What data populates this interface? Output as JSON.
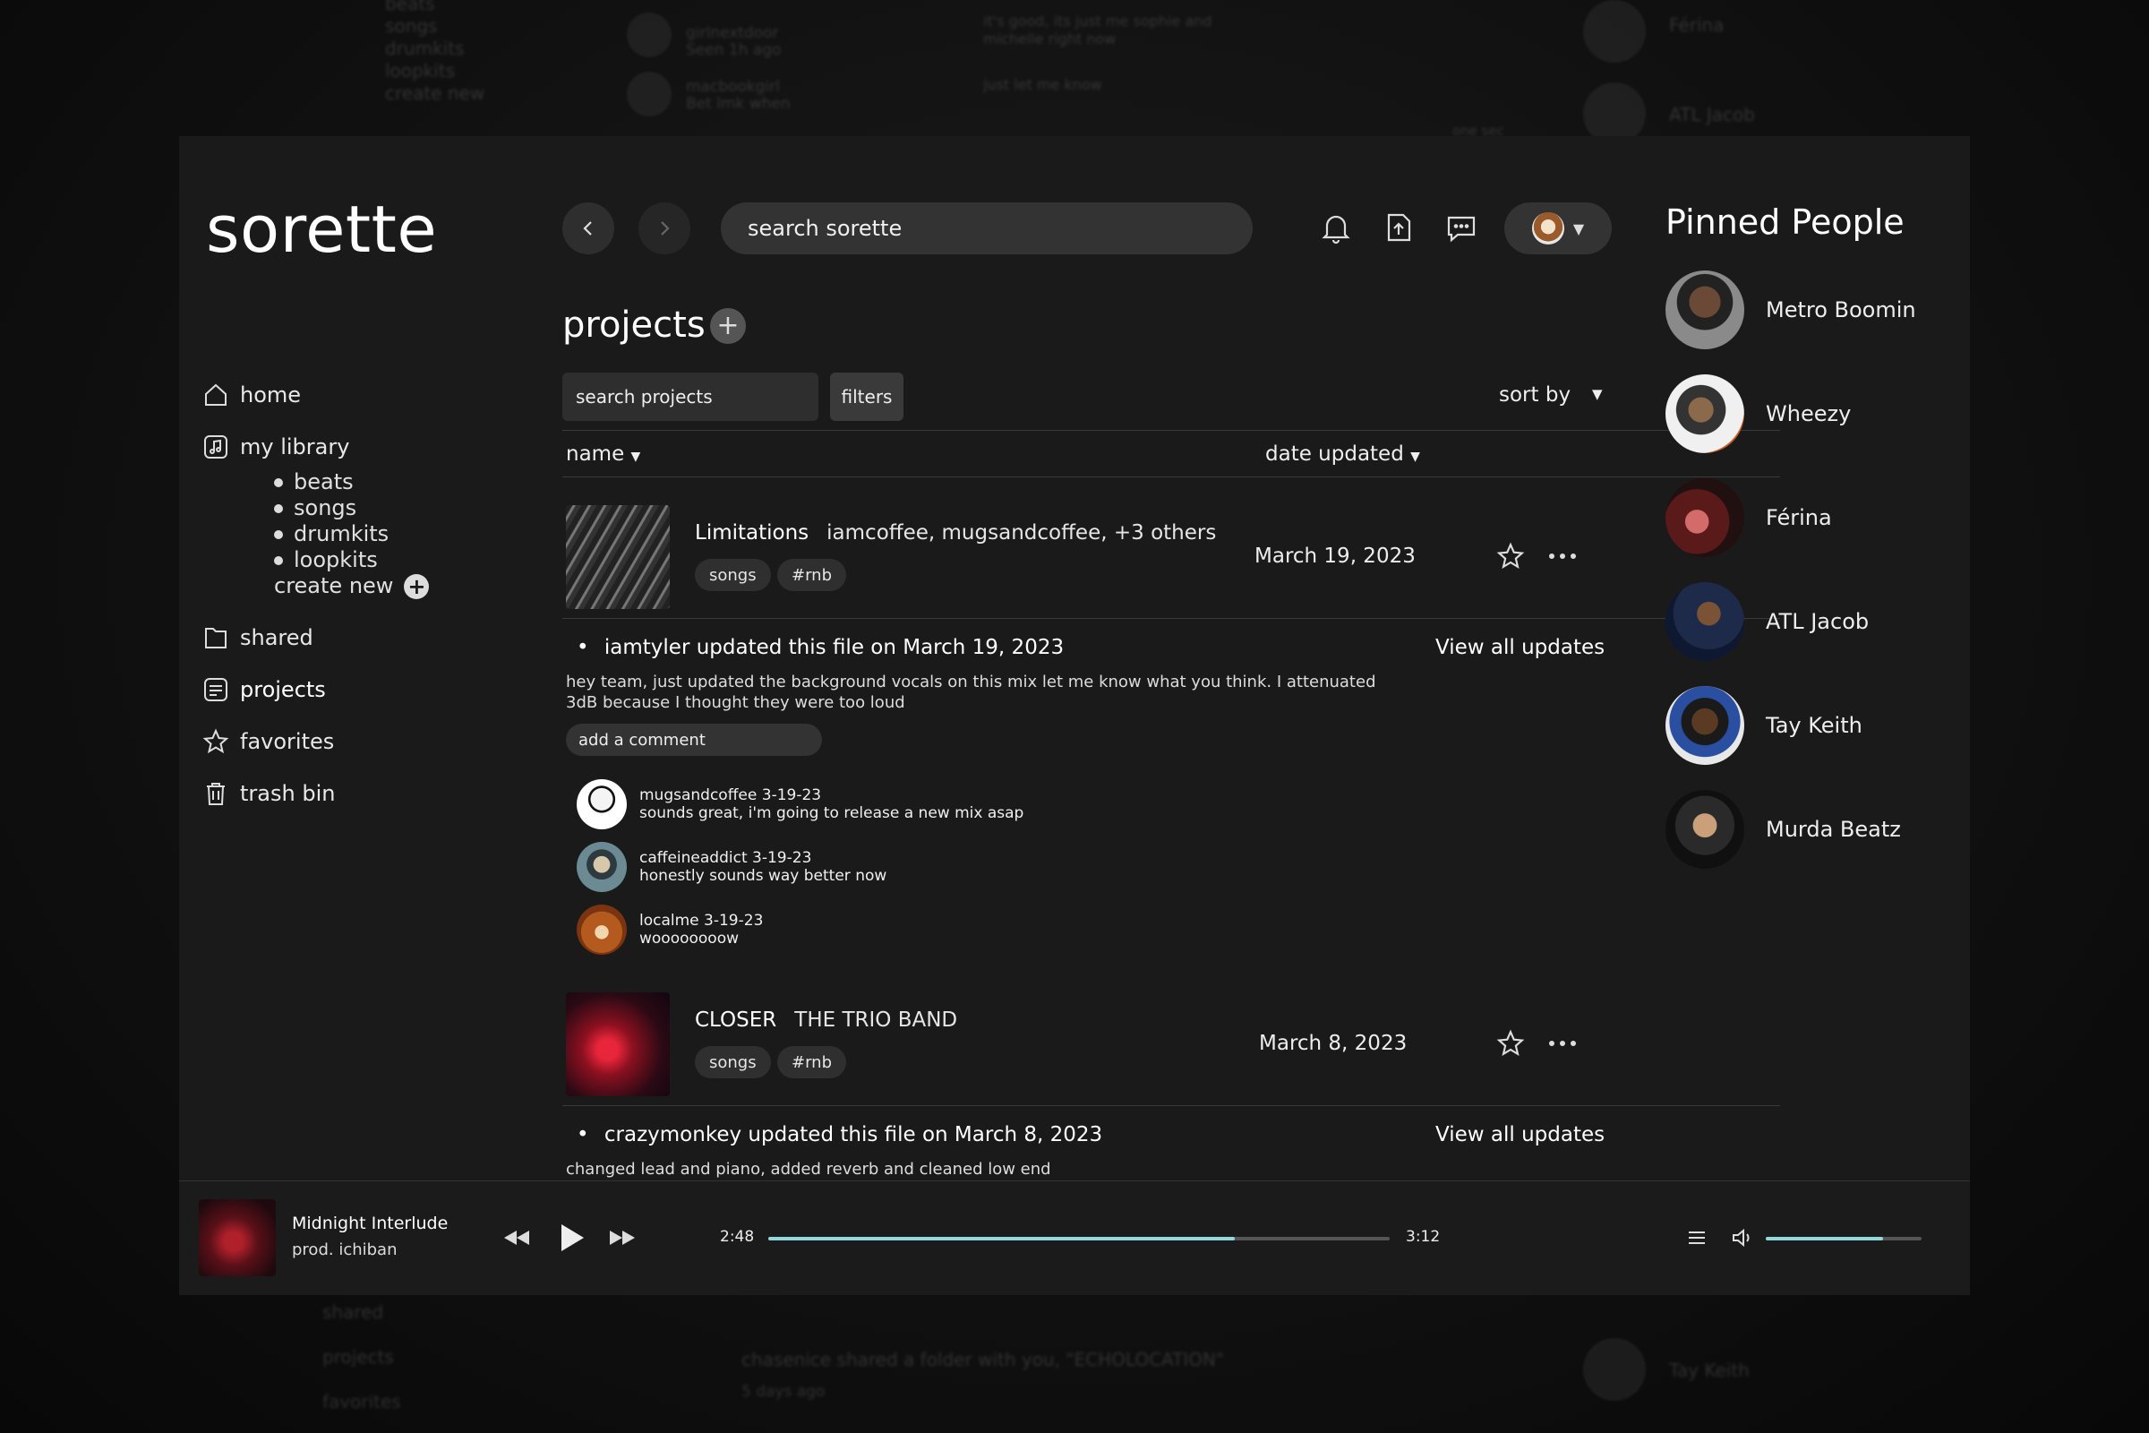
{
  "app": {
    "logo": "sorette"
  },
  "background": {
    "left_text": [
      "beats",
      "songs",
      "drumkits",
      "loopkits",
      "create new"
    ],
    "msgs": [
      {
        "name": "girlnextdoor",
        "sub": "Seen 1h ago"
      },
      {
        "name": "macbookgirl",
        "sub": "Bet lmk when"
      }
    ],
    "bubble1": "it's good, its just me sophie and michelle right now",
    "bubble2": "just let me know",
    "bubble3": "one sec",
    "right_names": [
      "Férina",
      "ATL Jacob"
    ],
    "bottom_text": "chasenice shared a folder with you, \"ECHOLOCATION\"",
    "bottom_sub": "5 days ago",
    "bottom_left": [
      "shared",
      "projects",
      "favorites"
    ],
    "bottom_right": "Tay Keith"
  },
  "sidebar": {
    "home": "home",
    "my_library": "my library",
    "library_items": [
      "beats",
      "songs",
      "drumkits",
      "loopkits"
    ],
    "create_new": "create new",
    "shared": "shared",
    "projects": "projects",
    "favorites": "favorites",
    "trash": "trash bin"
  },
  "topbar": {
    "search_placeholder": "search sorette"
  },
  "main": {
    "title": "projects",
    "search_projects": "search projects",
    "filters": "filters",
    "sort_by": "sort by",
    "col_name": "name",
    "col_date": "date updated",
    "projects": [
      {
        "title": "Limitations",
        "artists": "iamcoffee, mugsandcoffee, +3 others",
        "tags": [
          "songs",
          "#rnb"
        ],
        "date": "March 19, 2023",
        "update_user": "iamtyler",
        "update_text": "updated this file on March 19, 2023",
        "update_body": "hey team, just updated the background vocals on this mix let me know what you think. I attenuated 3dB because I thought they were too loud",
        "view_all": "View all updates"
      },
      {
        "title": "CLOSER",
        "artists": "THE TRIO BAND",
        "tags": [
          "songs",
          "#rnb"
        ],
        "date": "March 8, 2023",
        "update_user": "crazymonkey",
        "update_text": "updated this file on March 8, 2023",
        "update_body": "changed lead and piano, added reverb and cleaned low end",
        "view_all": "View all updates"
      }
    ],
    "add_comment": "add a comment",
    "comments": [
      {
        "head": "mugsandcoffee 3-19-23",
        "body": "sounds great, i'm going to release a new mix asap"
      },
      {
        "head": "caffeineaddict 3-19-23",
        "body": "honestly sounds way better now"
      },
      {
        "head": "localme 3-19-23",
        "body": "woooooooow"
      }
    ]
  },
  "pinned": {
    "title": "Pinned People",
    "people": [
      "Metro Boomin",
      "Wheezy",
      "Férina",
      "ATL Jacob",
      "Tay Keith",
      "Murda Beatz"
    ]
  },
  "player": {
    "track": "Midnight Interlude",
    "producer": "prod. ichiban",
    "elapsed": "2:48",
    "total": "3:12",
    "progress": 0.75,
    "volume": 0.75
  }
}
